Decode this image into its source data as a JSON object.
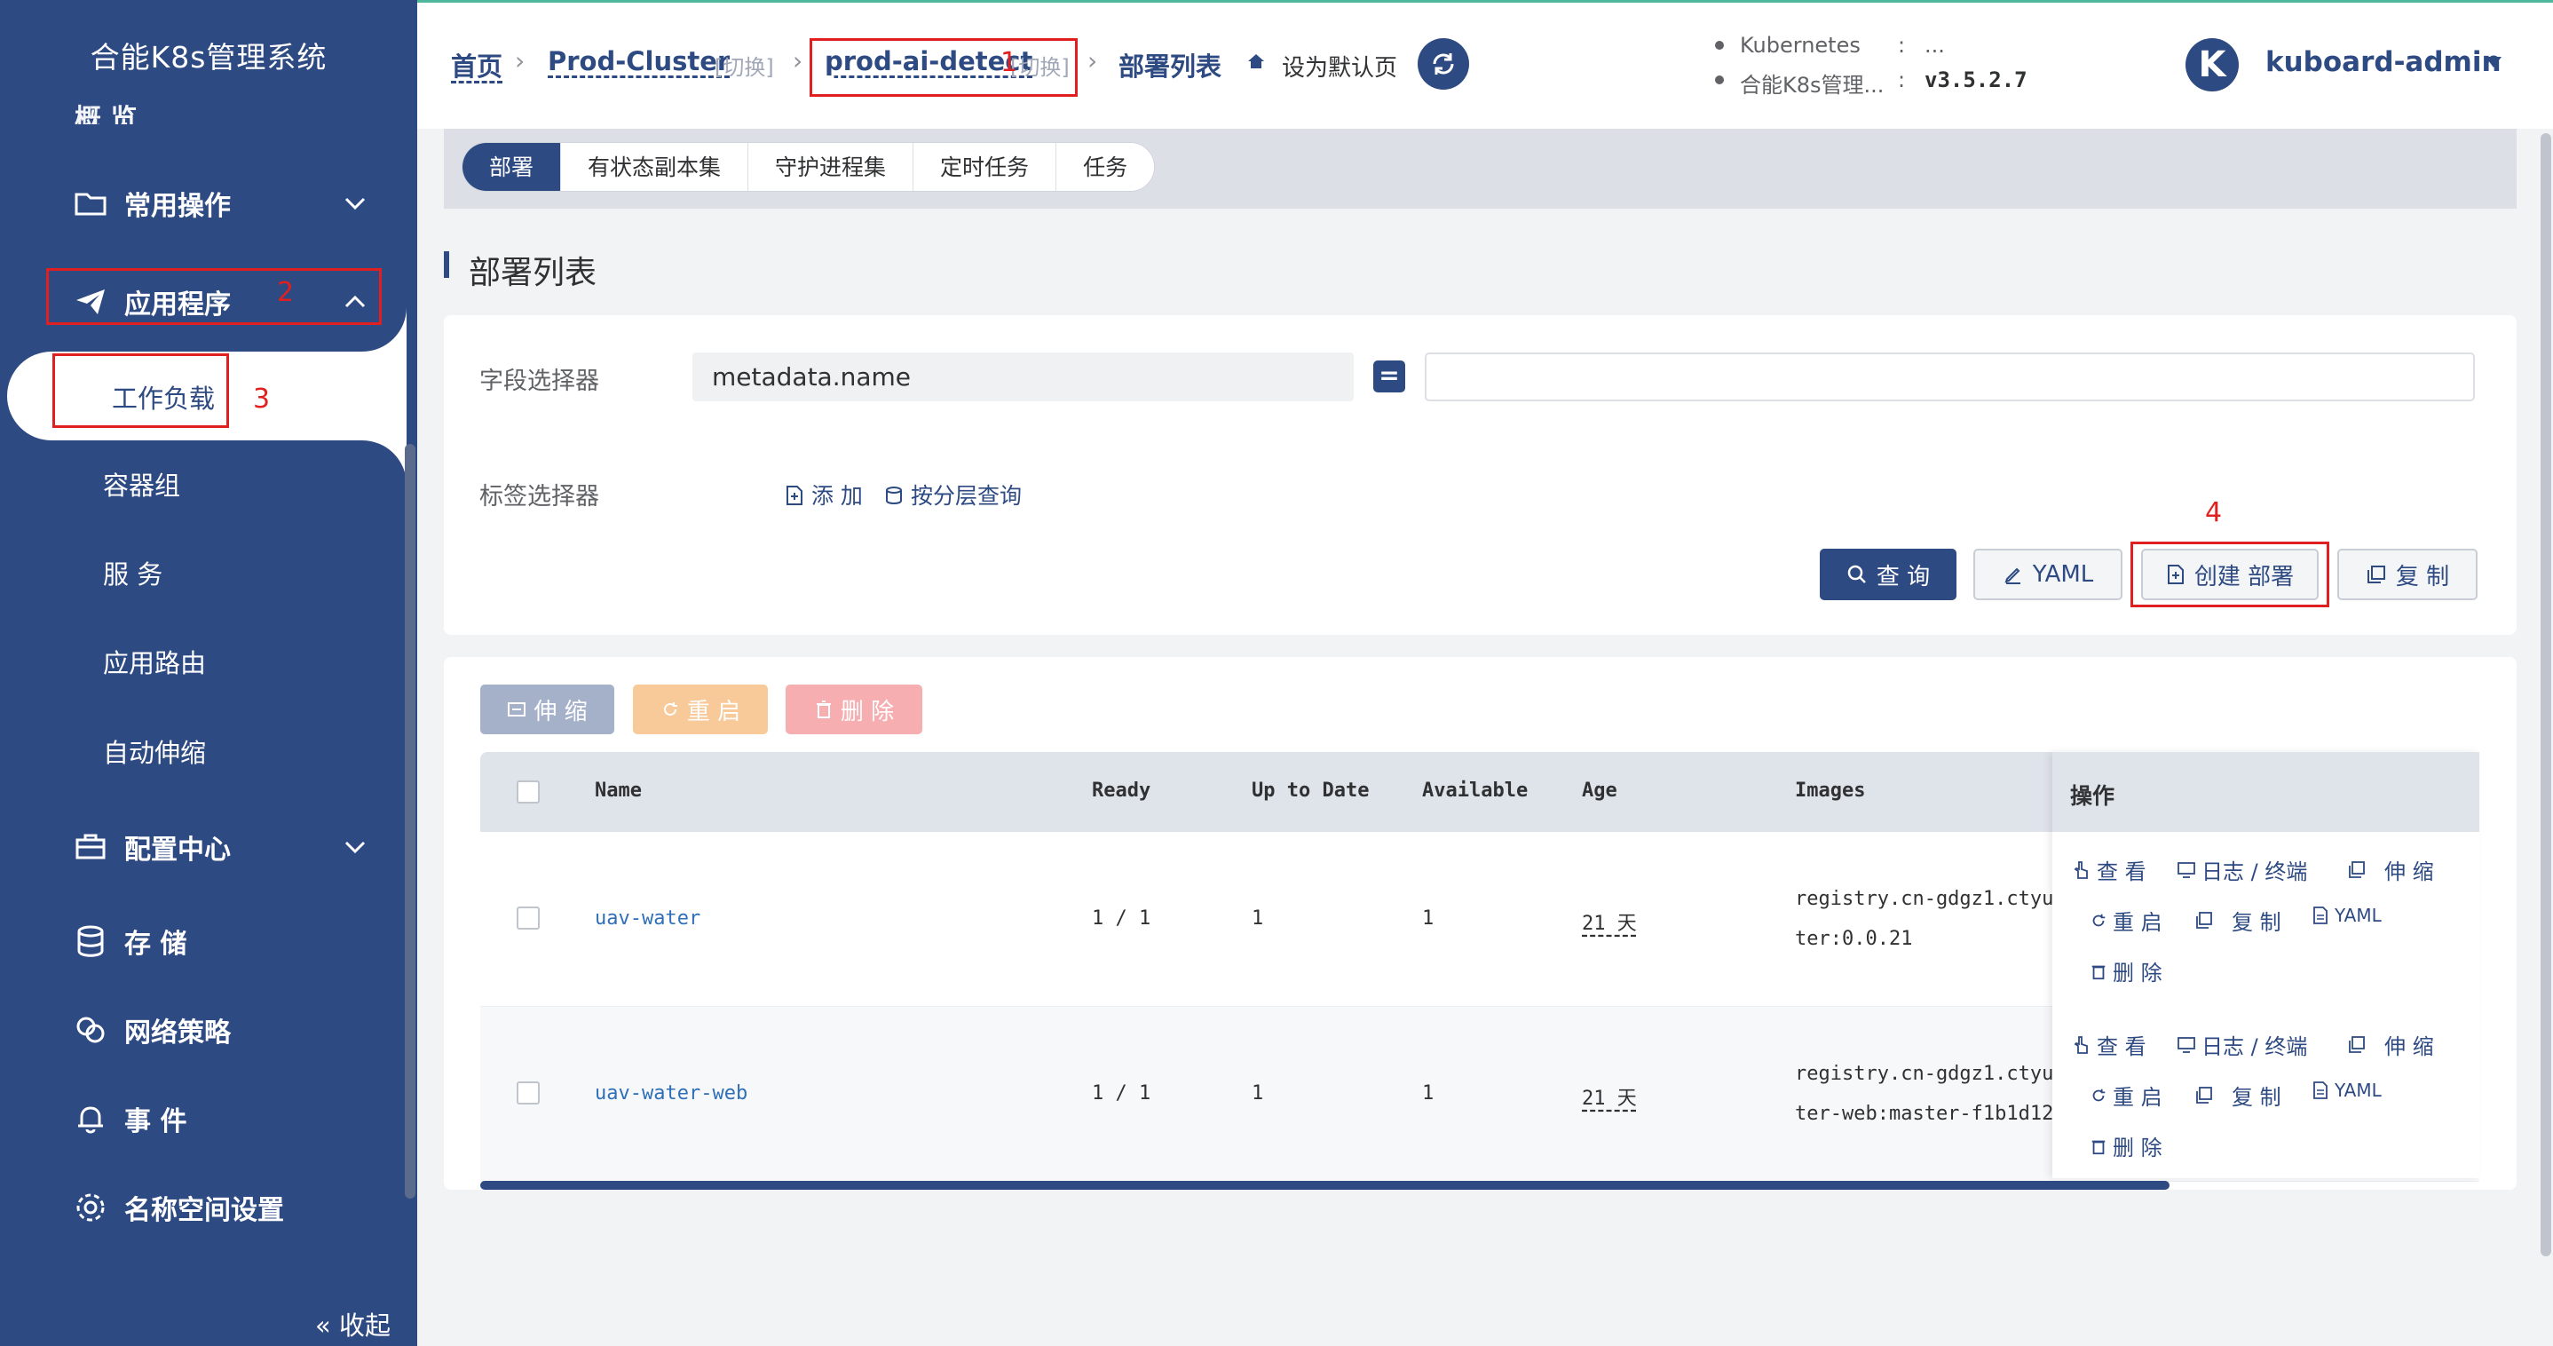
{
  "sidebar": {
    "system_title": "合能K8s管理系统",
    "partial_top_item": "概 览",
    "items": [
      {
        "label": "常用操作",
        "icon": "folder-icon",
        "expandable": true
      },
      {
        "label": "应用程序",
        "icon": "paper-plane-icon",
        "expandable": true,
        "expanded": true
      },
      {
        "label": "配置中心",
        "icon": "briefcase-icon",
        "expandable": true
      },
      {
        "label": "存 储",
        "icon": "database-icon"
      },
      {
        "label": "网络策略",
        "icon": "network-icon"
      },
      {
        "label": "事 件",
        "icon": "bell-icon"
      },
      {
        "label": "名称空间设置",
        "icon": "gear-icon"
      }
    ],
    "sub_items": [
      "工作负载",
      "容器组",
      "服 务",
      "应用路由",
      "自动伸缩"
    ],
    "active_sub": "工作负载",
    "collapse_label": "« 收起"
  },
  "header": {
    "breadcrumb": {
      "home": "首页",
      "cluster": "Prod-Cluster",
      "cluster_switch": "[切换]",
      "namespace": "prod-ai-detect",
      "namespace_switch": "[切换]",
      "current": "部署列表"
    },
    "set_default_label": "设为默认页",
    "versions": [
      {
        "name": "Kubernetes",
        "sep": ":",
        "value": "..."
      },
      {
        "name": "合能K8s管理...",
        "sep": ":",
        "value": "v3.5.2.7"
      }
    ],
    "avatar_letter": "K",
    "username": "kuboard-admin"
  },
  "tabs": [
    {
      "label": "部署",
      "active": true
    },
    {
      "label": "有状态副本集"
    },
    {
      "label": "守护进程集"
    },
    {
      "label": "定时任务"
    },
    {
      "label": "任务"
    }
  ],
  "page_title": "部署列表",
  "filter": {
    "field_selector_label": "字段选择器",
    "field_name_value": "metadata.name",
    "operator": "=",
    "field_value": "",
    "label_selector_label": "标签选择器",
    "add_label": "添 加",
    "layered_query_label": "按分层查询",
    "buttons": {
      "query": "查 询",
      "yaml": "YAML",
      "create": "创建 部署",
      "copy": "复 制"
    }
  },
  "table": {
    "actions": {
      "scale": "伸 缩",
      "restart": "重 启",
      "delete": "删 除"
    },
    "columns": [
      "Name",
      "Ready",
      "Up to Date",
      "Available",
      "Age",
      "Images",
      "操作"
    ],
    "rows": [
      {
        "name": "uav-water",
        "ready": "1 / 1",
        "up_to_date": "1",
        "available": "1",
        "age": "21 天",
        "image_line1": "registry.cn-gdgz1.ctyu",
        "image_line2": "ter:0.0.21"
      },
      {
        "name": "uav-water-web",
        "ready": "1 / 1",
        "up_to_date": "1",
        "available": "1",
        "age": "21 天",
        "image_line1": "registry.cn-gdgz1.ctyu",
        "image_line2": "ter-web:master-f1b1d12"
      }
    ],
    "row_ops": {
      "view": "查 看",
      "logs": "日志 / 终端",
      "scale": "伸 缩",
      "restart": "重 启",
      "copy": "复 制",
      "yaml": "YAML",
      "delete": "删 除"
    }
  },
  "annotations": [
    "1",
    "2",
    "3",
    "4"
  ],
  "colors": {
    "primary": "#2e4a82",
    "sidebar_bg": "#2e4a82",
    "annotation_red": "#e02020",
    "link_blue": "#2e6fb8",
    "restart_orange": "#f8c999",
    "delete_pink": "#f7aeb0"
  }
}
